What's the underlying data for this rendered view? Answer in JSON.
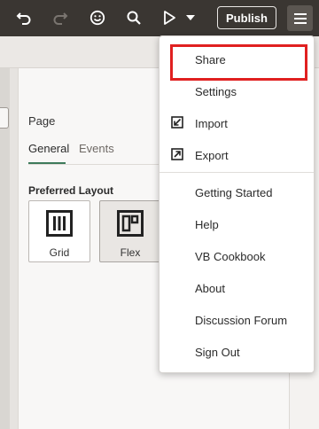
{
  "toolbar": {
    "undo_icon": "undo-icon",
    "redo_icon": "redo-icon",
    "feedback_icon": "smiley-icon",
    "search_icon": "search-icon",
    "run_icon": "play-icon",
    "run_menu_icon": "caret-down-icon",
    "publish_label": "Publish",
    "more_icon": "hamburger-menu-icon"
  },
  "properties": {
    "title": "Page",
    "tabs": [
      {
        "label": "General",
        "active": true
      },
      {
        "label": "Events",
        "active": false
      }
    ],
    "preferred_layout": {
      "title": "Preferred Layout",
      "options": [
        {
          "label": "Grid",
          "icon": "grid-layout-icon",
          "selected": false
        },
        {
          "label": "Flex",
          "icon": "flex-layout-icon",
          "selected": true
        }
      ]
    }
  },
  "menu": {
    "items": [
      {
        "label": "Share",
        "icon": null,
        "highlighted": true
      },
      {
        "label": "Settings",
        "icon": null
      },
      {
        "label": "Import",
        "icon": "import-icon"
      },
      {
        "label": "Export",
        "icon": "export-icon"
      },
      {
        "label": "Getting Started",
        "icon": null
      },
      {
        "label": "Help",
        "icon": null
      },
      {
        "label": "VB Cookbook",
        "icon": null
      },
      {
        "label": "About",
        "icon": null
      },
      {
        "label": "Discussion Forum",
        "icon": null
      },
      {
        "label": "Sign Out",
        "icon": null
      }
    ]
  },
  "colors": {
    "toolbar_bg": "#3a3632",
    "tab_accent": "#3e7b5b",
    "highlight": "#e02020"
  }
}
